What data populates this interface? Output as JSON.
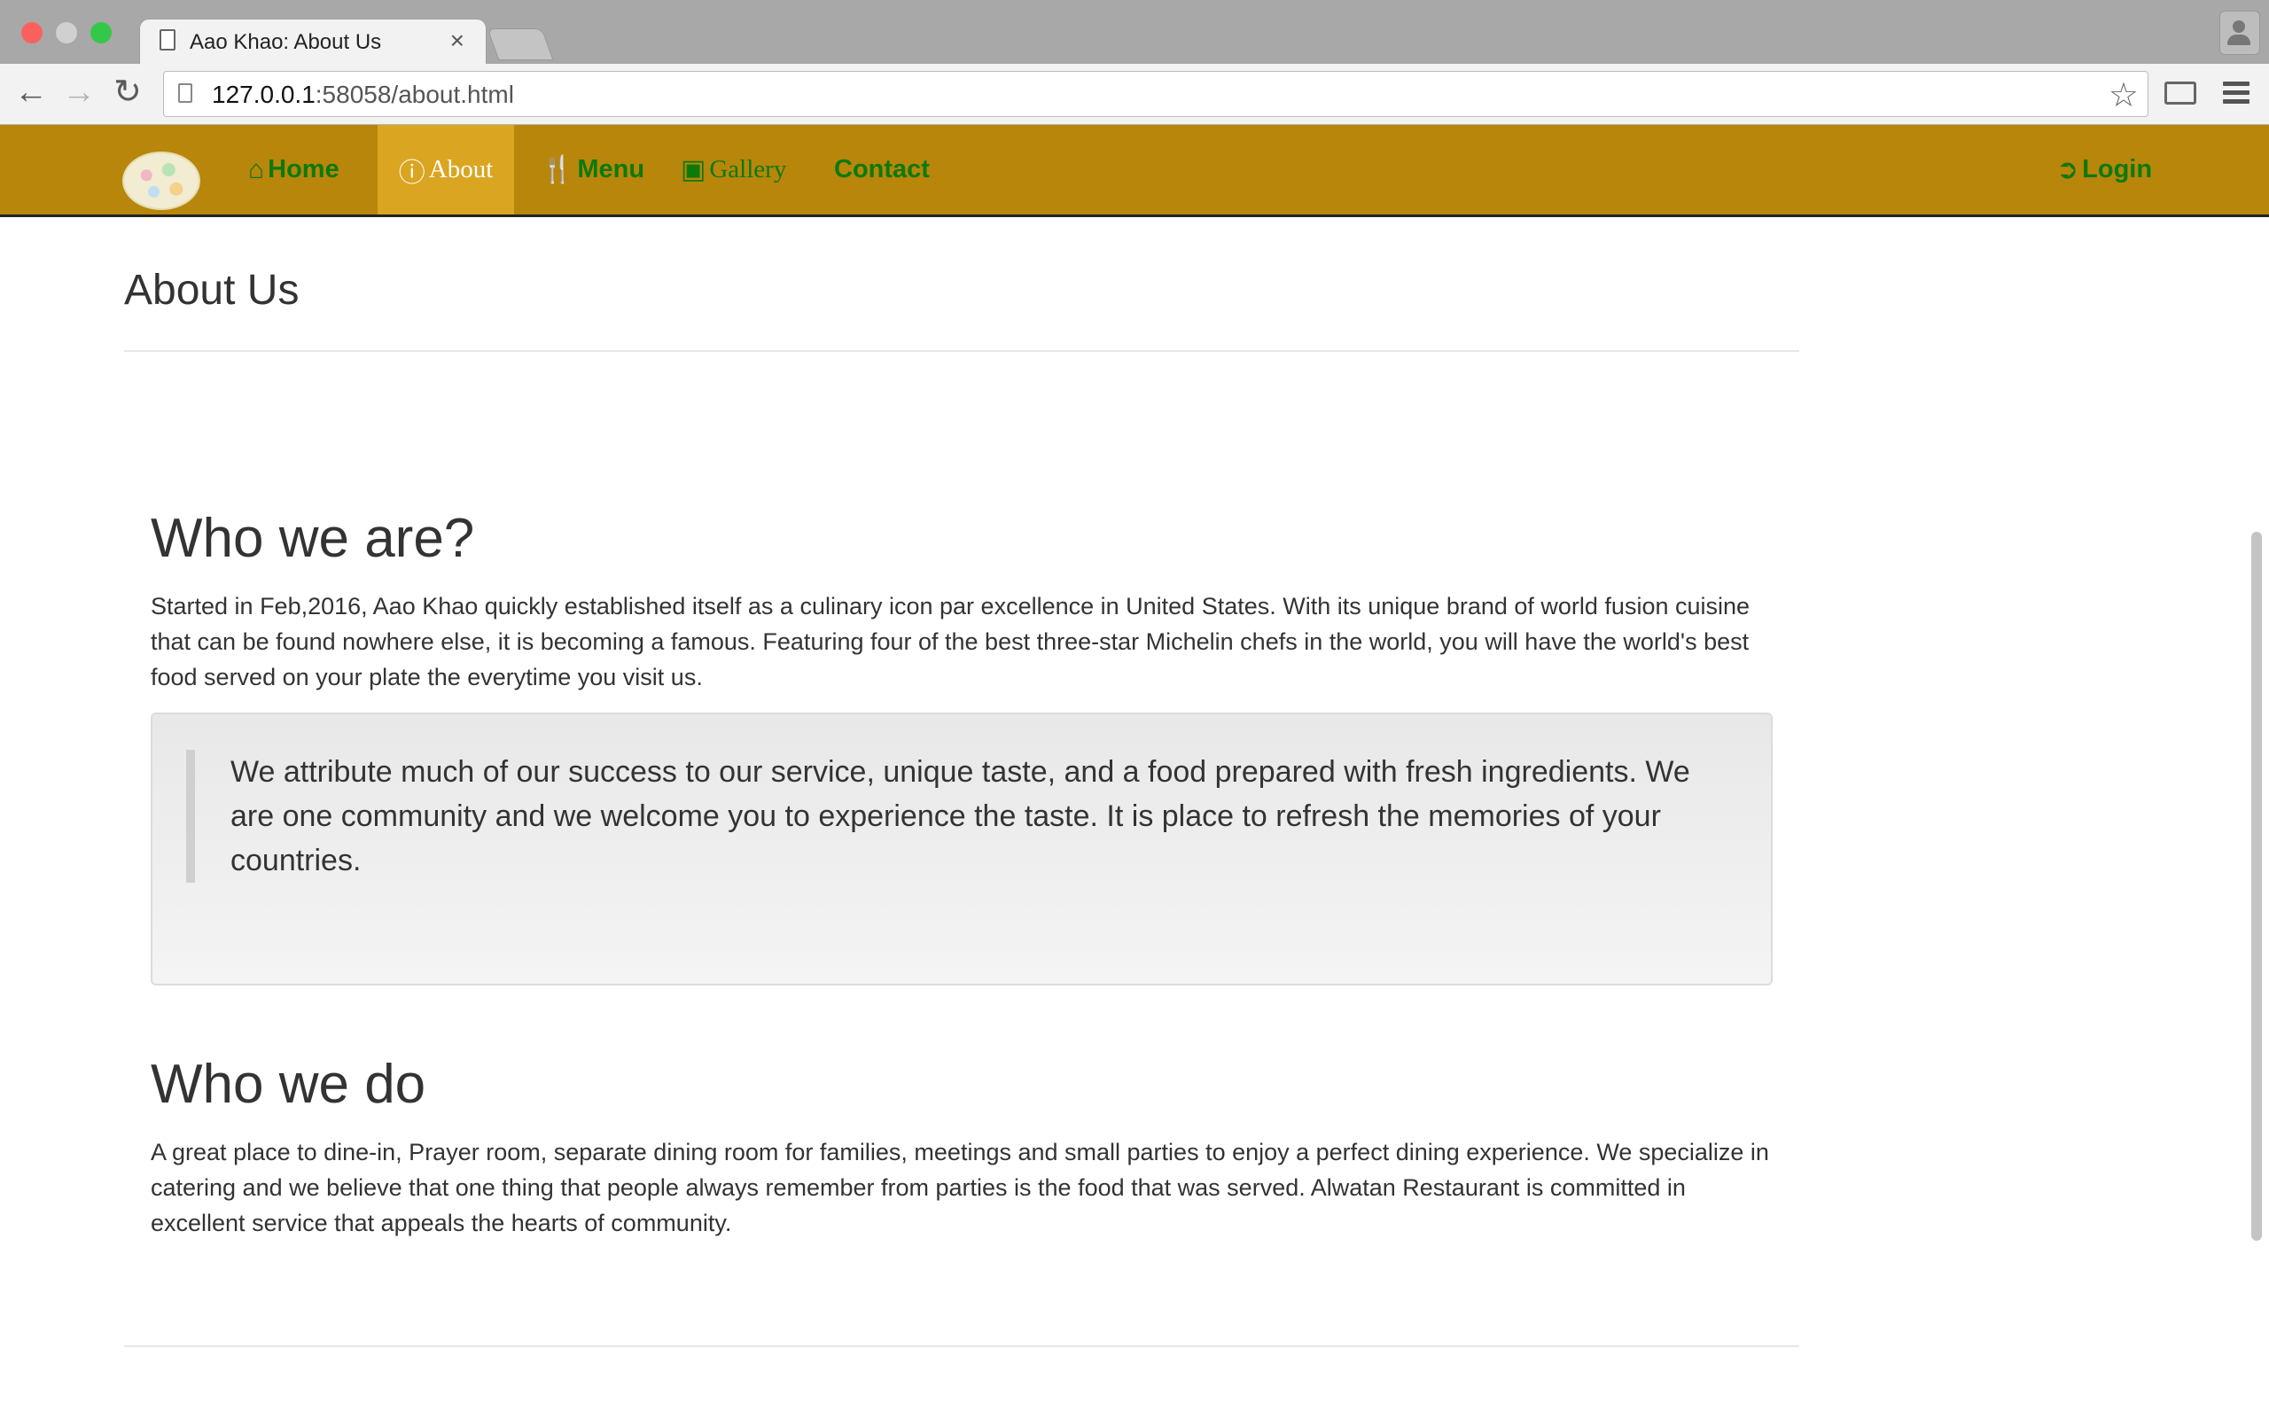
{
  "browser": {
    "tab_title": "Aao Khao: About Us",
    "tab_close": "×",
    "url_host": "127.0.0.1",
    "url_rest": ":58058/about.html",
    "back_glyph": "←",
    "forward_glyph": "→",
    "reload_glyph": "↻",
    "star_glyph": "☆"
  },
  "navbar": {
    "background": "#b8860b",
    "active_background": "#daa520",
    "link_color": "#0b7a0b",
    "items": [
      {
        "label": "Home",
        "icon": "home-icon",
        "glyph": "⌂"
      },
      {
        "label": "About",
        "icon": "info-icon",
        "glyph": "ⓘ"
      },
      {
        "label": "Menu",
        "icon": "cutlery-icon",
        "glyph": "🍴"
      },
      {
        "label": "Gallery",
        "icon": "picture-icon",
        "glyph": "▣"
      },
      {
        "label": "Contact",
        "icon": "",
        "glyph": ""
      }
    ],
    "login": {
      "label": "Login",
      "icon": "login-icon",
      "glyph": "➲"
    }
  },
  "page": {
    "title": "About Us",
    "sections": [
      {
        "heading": "Who we are?",
        "text": "Started in Feb,2016, Aao Khao quickly established itself as a culinary icon par excellence in United States. With its unique brand of world fusion cuisine that can be found nowhere else, it is becoming a famous. Featuring four of the best three-star Michelin chefs in the world, you will have the world's best food served on your plate the everytime you visit us."
      },
      {
        "heading": "Who we do",
        "text": "A great place to dine-in, Prayer room, separate dining room for families, meetings and small parties to enjoy a perfect dining experience. We specialize in catering and we believe that one thing that people always remember from parties is the food that was served. Alwatan Restaurant is committed in excellent service that appeals the hearts of community."
      }
    ],
    "quote": "We attribute much of our success to our service, unique taste, and a food prepared with fresh ingredients. We are one community and we welcome you to experience the taste. It is place to refresh the memories of your countries."
  }
}
